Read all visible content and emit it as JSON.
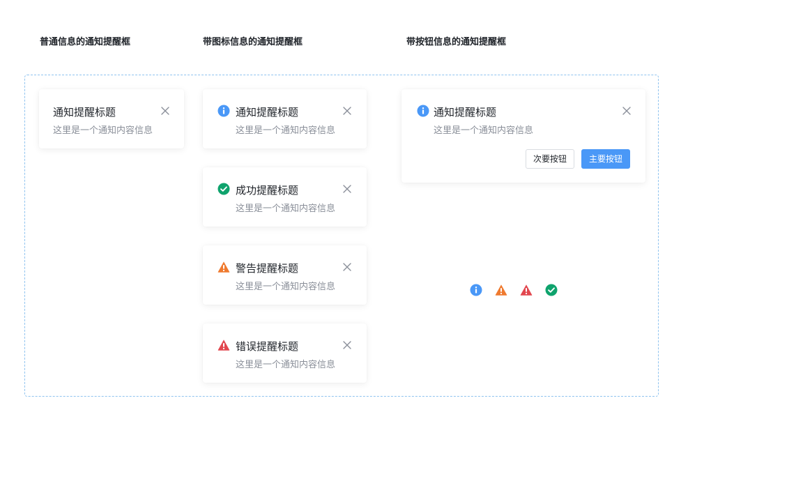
{
  "sections": {
    "plain_title": "普通信息的通知提醒框",
    "icon_title": "带图标信息的通知提醒框",
    "button_title": "带按钮信息的通知提醒框"
  },
  "plain_card": {
    "title": "通知提醒标题",
    "content": "这里是一个通知内容信息"
  },
  "icon_cards": [
    {
      "type": "info",
      "icon": "info-icon",
      "title": "通知提醒标题",
      "content": "这里是一个通知内容信息"
    },
    {
      "type": "success",
      "icon": "check-circle-icon",
      "title": "成功提醒标题",
      "content": "这里是一个通知内容信息"
    },
    {
      "type": "warning",
      "icon": "warning-triangle-icon",
      "title": "警告提醒标题",
      "content": "这里是一个通知内容信息"
    },
    {
      "type": "error",
      "icon": "error-triangle-icon",
      "title": "错误提醒标题",
      "content": "这里是一个通知内容信息"
    }
  ],
  "button_card": {
    "icon": "info-icon",
    "title": "通知提醒标题",
    "content": "这里是一个通知内容信息",
    "secondary_button": "次要按钮",
    "primary_button": "主要按钮"
  },
  "icon_legend": [
    "info-icon",
    "warning-triangle-icon",
    "error-triangle-icon",
    "check-circle-icon"
  ],
  "colors": {
    "info": "#4a98f7",
    "success": "#0fa36d",
    "warning": "#ef7a2f",
    "error": "#e2474f",
    "primary_button": "#4a98f7",
    "frame_border": "#8fc3ef"
  }
}
